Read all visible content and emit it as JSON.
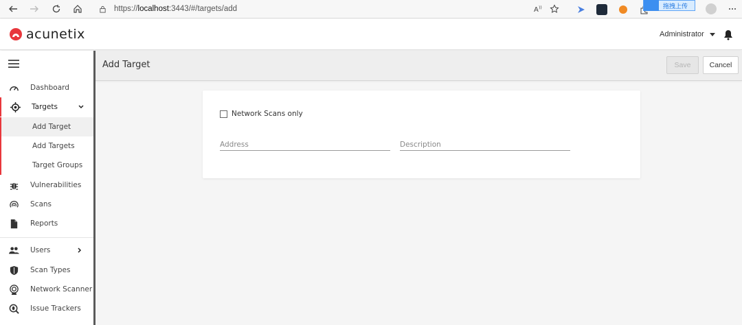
{
  "browser": {
    "url_prefix": "https://",
    "url_host": "localhost",
    "url_rest": ":3443/#/targets/add",
    "badge_text": "拖拽上传"
  },
  "header": {
    "logo_text": "acunetix",
    "user_label": "Administrator"
  },
  "sidebar": {
    "items": [
      {
        "label": "Dashboard",
        "icon": "gauge-icon"
      },
      {
        "label": "Targets",
        "icon": "crosshair-icon"
      },
      {
        "label": "Vulnerabilities",
        "icon": "bug-icon"
      },
      {
        "label": "Scans",
        "icon": "radar-icon"
      },
      {
        "label": "Reports",
        "icon": "document-icon"
      },
      {
        "label": "Users",
        "icon": "users-icon"
      },
      {
        "label": "Scan Types",
        "icon": "shield-icon"
      },
      {
        "label": "Network Scanner",
        "icon": "network-scanner-icon"
      },
      {
        "label": "Issue Trackers",
        "icon": "magnifier-bug-icon"
      }
    ],
    "target_submenu": [
      "Add Target",
      "Add Targets",
      "Target Groups"
    ]
  },
  "toolbar": {
    "title": "Add Target",
    "save_label": "Save",
    "cancel_label": "Cancel"
  },
  "form": {
    "network_scans_label": "Network Scans only",
    "network_scans_checked": false,
    "address_placeholder": "Address",
    "description_placeholder": "Description"
  },
  "colors": {
    "brand_red": "#e8373c",
    "sidebar_edge": "#5a5a5a",
    "content_bg": "#f5f5f5"
  }
}
